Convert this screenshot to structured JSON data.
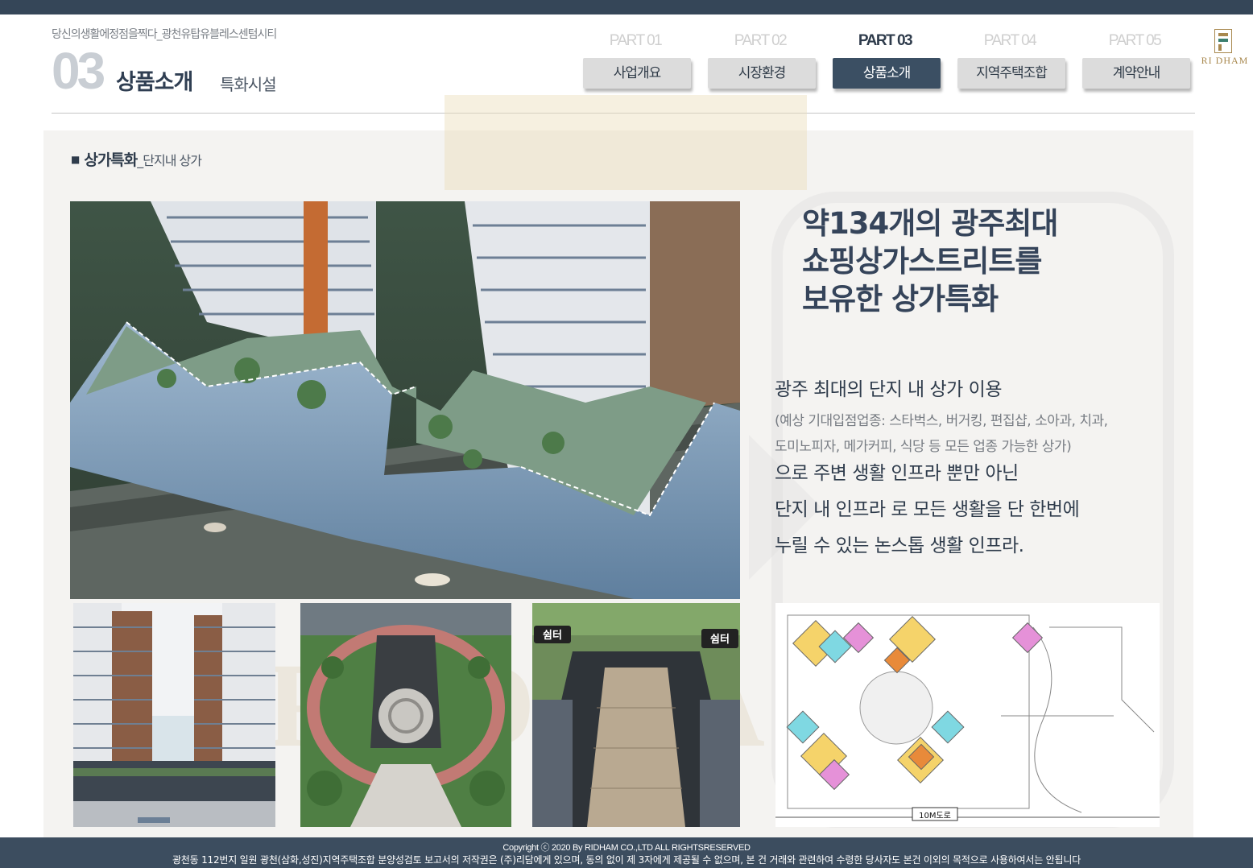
{
  "header": {
    "tagline": "당신의생활에정점을찍다_광천유탑유블레스센텀시티",
    "section_number": "03",
    "section_title": "상품소개",
    "section_subtitle": "특화시설"
  },
  "nav": {
    "parts": [
      {
        "part": "PART 01",
        "label": "사업개요",
        "active": false
      },
      {
        "part": "PART 02",
        "label": "시장환경",
        "active": false
      },
      {
        "part": "PART 03",
        "label": "상품소개",
        "active": true
      },
      {
        "part": "PART 04",
        "label": "지역주택조합",
        "active": false
      },
      {
        "part": "PART 05",
        "label": "계약안내",
        "active": false
      }
    ]
  },
  "brand": {
    "name": "RI DHAM",
    "accent": "#a8884e"
  },
  "content": {
    "sub_heading": "상가특화",
    "sub_heading_detail": "_단지내 상가",
    "headline": [
      "약134개의 광주최대",
      "쇼핑상가스트리트를",
      "보유한 상가특화"
    ],
    "body_line1": "광주 최대의 단지 내 상가 이용",
    "body_note": [
      "(예상 기대입점업종: 스타벅스, 버거킹, 편집샵, 소아과, 치과,",
      "도미노피자, 메가커피, 식당 등 모든 업종 가능한 상가)"
    ],
    "body_lines": [
      "으로 주변 생활 인프라 뿐만 아닌",
      "단지 내 인프라 로 모든 생활을 단 한번에",
      "누릴 수 있는 논스톱 생활 인프라."
    ]
  },
  "images": {
    "shelter_label": "쉼터",
    "road_label": "10M도로"
  },
  "footer": {
    "copyright": "Copyright ⓒ 2020 By RIDHAM CO.,LTD ALL RIGHTSRESERVED",
    "notice": "광천동 112번지 일원 광천(삼화,성진)지역주택조합 분양성검토 보고서의 저작권은 (주)리담에게 있으며, 동의 없이 제 3자에게 제공될 수 없으며, 본 건 거래와 관련하여 수령한 당사자도 본건 이외의 목적으로 사용하여서는 안됩니다"
  },
  "colors": {
    "navy": "#354658",
    "active_tab": "#3b4f63",
    "tab": "#dcdcdc",
    "content_bg": "#f4f3f1"
  }
}
